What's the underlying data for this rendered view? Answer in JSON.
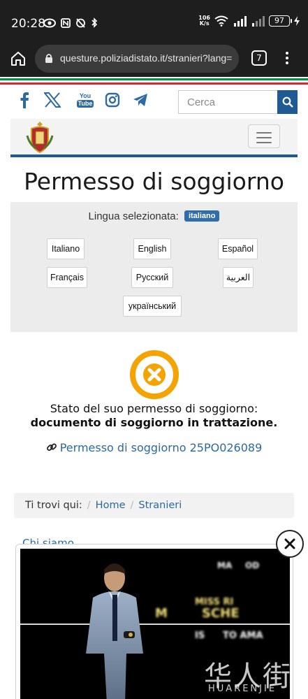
{
  "status_bar": {
    "time": "20:28",
    "network_speed_value": "106",
    "network_speed_unit": "K/s",
    "battery": "97"
  },
  "browser": {
    "url": "questure.poliziadistato.it/stranieri?lang=",
    "tab_count": "7"
  },
  "header": {
    "search_placeholder": "Cerca",
    "social_icons": [
      "facebook-icon",
      "x-icon",
      "youtube-icon",
      "instagram-icon",
      "telegram-icon"
    ],
    "youtube_text_top": "You",
    "youtube_text_bottom": "Tube"
  },
  "main": {
    "title": "Permesso di soggiorno",
    "language_label": "Lingua selezionata:",
    "language_selected": "italiano",
    "languages": [
      "Italiano",
      "English",
      "Español",
      "Français",
      "Русский",
      "العربية",
      "український"
    ],
    "status_prefix": "Stato del suo permesso di soggiorno: ",
    "status_value": "documento di soggiorno in trattazione.",
    "permit_link": "Permesso di soggiorno 25PO026089"
  },
  "breadcrumb": {
    "label": "Ti trovi qui:",
    "items": [
      "Home",
      "Stranieri"
    ]
  },
  "footer_link": "Chi siamo",
  "video": {
    "texts": [
      "MA",
      "OD",
      "MISS RI",
      "M",
      "SCHE",
      "IS",
      "TO AMA"
    ]
  },
  "watermark": {
    "main": "华人街",
    "sub": "HUARENJIE"
  },
  "colors": {
    "primary_blue": "#1f5a95",
    "link_blue": "#2c6a9e",
    "status_orange": "#f4a300",
    "flag_green": "#009246",
    "flag_red": "#ce2b37"
  }
}
